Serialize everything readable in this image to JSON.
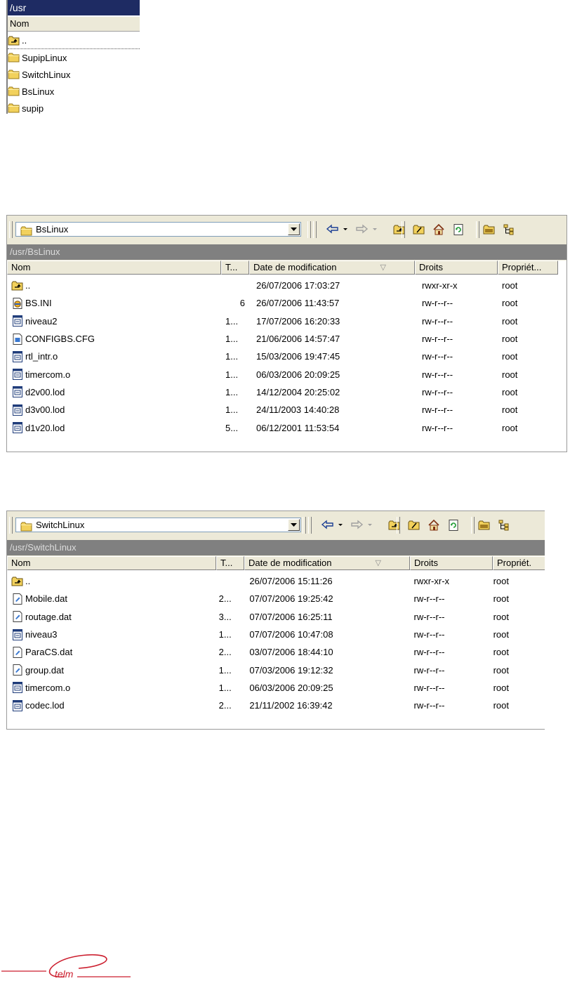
{
  "panel1": {
    "title": "/usr",
    "column_name": "Nom",
    "items": [
      {
        "name": "..",
        "icon": "folder-up-icon"
      },
      {
        "name": "SupipLinux",
        "icon": "folder-icon"
      },
      {
        "name": "SwitchLinux",
        "icon": "folder-icon"
      },
      {
        "name": "BsLinux",
        "icon": "folder-icon"
      },
      {
        "name": "supip",
        "icon": "folder-icon"
      }
    ]
  },
  "panel2": {
    "combo_value": "BsLinux",
    "path": "/usr/BsLinux",
    "columns": {
      "name": "Nom",
      "size": "T...",
      "date": "Date de modification",
      "rights": "Droits",
      "owner": "Propriét..."
    },
    "files": [
      {
        "name": "..",
        "size": "",
        "date": "26/07/2006 17:03:27",
        "rights": "rwxr-xr-x",
        "owner": "root",
        "icon": "folder-up-icon"
      },
      {
        "name": "BS.INI",
        "size": "6",
        "date": "26/07/2006 11:43:57",
        "rights": "rw-r--r--",
        "owner": "root",
        "icon": "ini-file-icon"
      },
      {
        "name": "niveau2",
        "size": "1...",
        "date": "17/07/2006 16:20:33",
        "rights": "rw-r--r--",
        "owner": "root",
        "icon": "binary-file-icon"
      },
      {
        "name": "CONFIGBS.CFG",
        "size": "1...",
        "date": "21/06/2006 14:57:47",
        "rights": "rw-r--r--",
        "owner": "root",
        "icon": "cfg-file-icon"
      },
      {
        "name": "rtl_intr.o",
        "size": "1...",
        "date": "15/03/2006 19:47:45",
        "rights": "rw-r--r--",
        "owner": "root",
        "icon": "binary-file-icon"
      },
      {
        "name": "timercom.o",
        "size": "1...",
        "date": "06/03/2006 20:09:25",
        "rights": "rw-r--r--",
        "owner": "root",
        "icon": "binary-file-icon"
      },
      {
        "name": "d2v00.lod",
        "size": "1...",
        "date": "14/12/2004 20:25:02",
        "rights": "rw-r--r--",
        "owner": "root",
        "icon": "binary-file-icon"
      },
      {
        "name": "d3v00.lod",
        "size": "1...",
        "date": "24/11/2003 14:40:28",
        "rights": "rw-r--r--",
        "owner": "root",
        "icon": "binary-file-icon"
      },
      {
        "name": "d1v20.lod",
        "size": "5...",
        "date": "06/12/2001 11:53:54",
        "rights": "rw-r--r--",
        "owner": "root",
        "icon": "binary-file-icon"
      }
    ]
  },
  "panel3": {
    "combo_value": "SwitchLinux",
    "path": "/usr/SwitchLinux",
    "columns": {
      "name": "Nom",
      "size": "T...",
      "date": "Date de modification",
      "rights": "Droits",
      "owner": "Propriét."
    },
    "files": [
      {
        "name": "..",
        "size": "",
        "date": "26/07/2006 15:11:26",
        "rights": "rwxr-xr-x",
        "owner": "root",
        "icon": "folder-up-icon"
      },
      {
        "name": "Mobile.dat",
        "size": "2...",
        "date": "07/07/2006 19:25:42",
        "rights": "rw-r--r--",
        "owner": "root",
        "icon": "text-file-icon"
      },
      {
        "name": "routage.dat",
        "size": "3...",
        "date": "07/07/2006 16:25:11",
        "rights": "rw-r--r--",
        "owner": "root",
        "icon": "text-file-icon"
      },
      {
        "name": "niveau3",
        "size": "1...",
        "date": "07/07/2006 10:47:08",
        "rights": "rw-r--r--",
        "owner": "root",
        "icon": "binary-file-icon"
      },
      {
        "name": "ParaCS.dat",
        "size": "2...",
        "date": "03/07/2006 18:44:10",
        "rights": "rw-r--r--",
        "owner": "root",
        "icon": "text-file-icon"
      },
      {
        "name": "group.dat",
        "size": "1...",
        "date": "07/03/2006 19:12:32",
        "rights": "rw-r--r--",
        "owner": "root",
        "icon": "text-file-icon"
      },
      {
        "name": "timercom.o",
        "size": "1...",
        "date": "06/03/2006 20:09:25",
        "rights": "rw-r--r--",
        "owner": "root",
        "icon": "binary-file-icon"
      },
      {
        "name": "codec.lod",
        "size": "2...",
        "date": "21/11/2002 16:39:42",
        "rights": "rw-r--r--",
        "owner": "root",
        "icon": "binary-file-icon"
      }
    ]
  },
  "toolbar_icons": [
    "back-arrow-icon",
    "back-dropdown-icon",
    "forward-arrow-icon",
    "forward-dropdown-icon",
    "parent-folder-icon",
    "rename-folder-icon",
    "home-icon",
    "refresh-icon",
    "open-folder-icon",
    "tree-view-icon"
  ],
  "logo": {
    "text": "telm"
  },
  "colors": {
    "titlebar": "#1e2b63",
    "pathbar": "#808080",
    "chrome": "#ece9d8",
    "logo": "#cc1f2f",
    "folder": "#f2d15c"
  }
}
